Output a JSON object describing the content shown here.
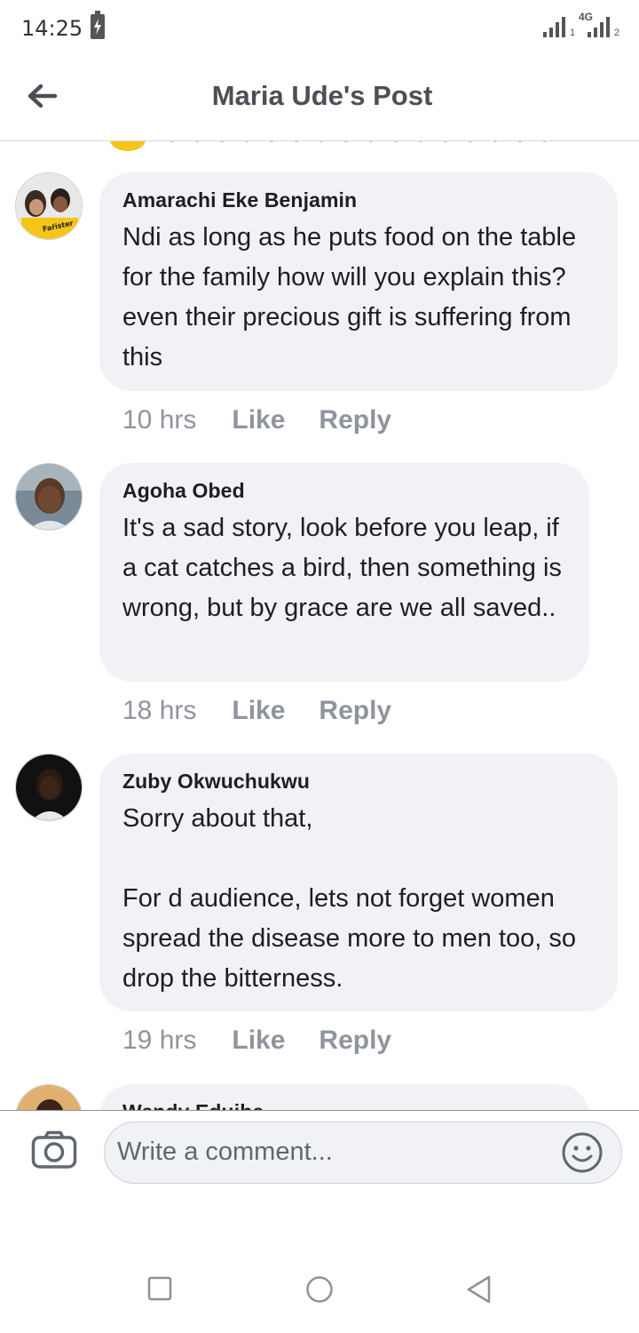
{
  "status_bar": {
    "time": "14:25",
    "sim1_label": "1",
    "sim2_label": "2",
    "network_type": "4G",
    "icons": [
      "battery-charging-icon",
      "signal-sim1-icon",
      "signal-sim2-icon"
    ]
  },
  "header": {
    "title": "Maria Ude's Post",
    "back_icon": "arrow-left-icon"
  },
  "comments": [
    {
      "author": "Amarachi Eke Benjamin",
      "text": "Ndi as long as he puts food on the table for the family how will you explain this?even their precious gift is suffering from this",
      "time": "10 hrs",
      "like_label": "Like",
      "reply_label": "Reply",
      "avatar_label": "Faṙister"
    },
    {
      "author": "Agoha Obed",
      "text": "It's a sad story, look before you leap, if a cat catches a bird, then something is wrong, but by grace are we all saved..",
      "time": "18 hrs",
      "like_label": "Like",
      "reply_label": "Reply"
    },
    {
      "author": "Zuby Okwuchukwu",
      "text": "Sorry about that,\n\nFor d audience, lets not forget women spread the disease more to men too, so drop the bitterness.",
      "time": "19 hrs",
      "like_label": "Like",
      "reply_label": "Reply"
    },
    {
      "author": "Wendy Eduibe"
    }
  ],
  "composer": {
    "placeholder": "Write a comment...",
    "camera_icon": "camera-icon",
    "emoji_icon": "smiley-icon"
  },
  "nav_bar": {
    "icons": [
      "recents-square-icon",
      "home-circle-icon",
      "back-triangle-icon"
    ]
  },
  "colors": {
    "bubble_bg": "#f0f2f5",
    "meta_text": "#90949c",
    "title_text": "#4b4f56",
    "body_text": "#1c1e21"
  }
}
